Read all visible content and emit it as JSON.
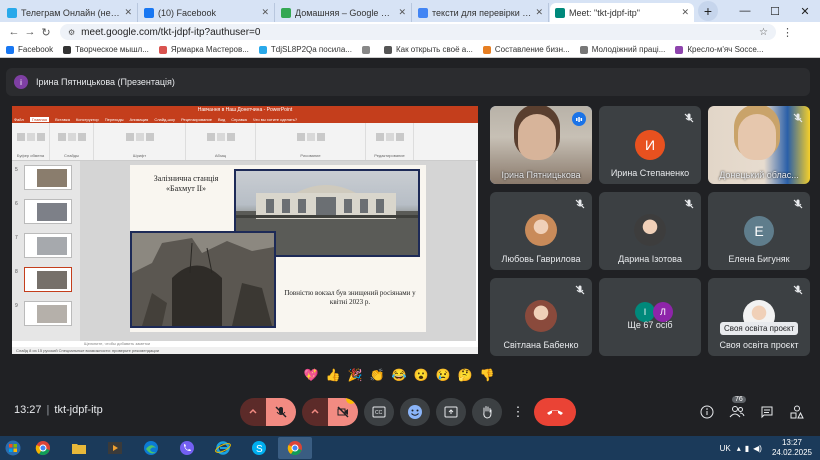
{
  "browser": {
    "tabs": [
      {
        "title": "Телеграм Онлайн (неофициа...",
        "color": "#29a9ea",
        "icon": "telegram-icon",
        "active": false
      },
      {
        "title": "(10) Facebook",
        "color": "#1877f2",
        "icon": "facebook-icon",
        "active": false
      },
      {
        "title": "Домашняя – Google Диск",
        "color": "#34a853",
        "icon": "drive-icon",
        "active": false
      },
      {
        "title": "тексти для перевірки - Goog...",
        "color": "#4285f4",
        "icon": "docs-icon",
        "active": false
      },
      {
        "title": "Meet: \"tkt-jdpf-itp\"",
        "color": "#00897b",
        "icon": "meet-icon",
        "active": true
      }
    ],
    "url": "meet.google.com/tkt-jdpf-itp?authuser=0",
    "bookmarks": [
      {
        "label": "Facebook",
        "color": "#1877f2"
      },
      {
        "label": "Творческое мышл...",
        "color": "#333333"
      },
      {
        "label": "Ярмарка Мастеров...",
        "color": "#d9534f"
      },
      {
        "label": "TdjSL8P2Qa посила...",
        "color": "#29a9ea"
      },
      {
        "label": "",
        "color": "#888888"
      },
      {
        "label": "Как открыть своё а...",
        "color": "#555555"
      },
      {
        "label": "Составление бизн...",
        "color": "#e67e22"
      },
      {
        "label": "Молодіжний праці...",
        "color": "#777777"
      },
      {
        "label": "Кресло-м'яч Socce...",
        "color": "#8e44ad"
      }
    ]
  },
  "presentation": {
    "presenter_initial": "і",
    "presenter_label": "Ірина Пятницькова (Презентація)",
    "ppt_title": "Навчання в Наш Донетчина - PowerPoint",
    "ribbon_tabs": [
      "Файл",
      "Главная",
      "Вставка",
      "Конструктор",
      "Переходы",
      "Анимация",
      "Слайд-шоу",
      "Рецензирование",
      "Вид",
      "Справка",
      "Что вы хотите сделать?"
    ],
    "ribbon_groups": [
      "Буфер обмена",
      "Слайды",
      "Шрифт",
      "Абзац",
      "Рисование",
      "Редактирование"
    ],
    "slide_title": "Залізнична станція «Бахмут ІІ»",
    "slide_caption": "Повністю вокзал був знищений росіянами у квітні 2023 р.",
    "notes_placeholder": "Щелкните, чтобы добавить заметки",
    "status_text": "Слайд 8 из 15   русский   Специальные возможности: проверьте рекомендации",
    "thumb_numbers": [
      "5",
      "6",
      "7",
      "8",
      "9"
    ]
  },
  "participants": [
    {
      "name": "Ірина Пятницькова",
      "type": "photo",
      "speaking": true
    },
    {
      "name": "Ирина Степаненко",
      "type": "letter",
      "letter": "И",
      "color": "#e8511f",
      "muted": true
    },
    {
      "name": "Донецький облас...",
      "type": "photo",
      "muted": true
    },
    {
      "name": "Любовь Гаврилова",
      "type": "avatar",
      "muted": true
    },
    {
      "name": "Дарина Ізотова",
      "type": "avatar",
      "muted": true
    },
    {
      "name": "Елена Бигуняк",
      "type": "letter",
      "letter": "Е",
      "color": "#5f7d8c",
      "muted": true
    },
    {
      "name": "Світлана Бабенко",
      "type": "avatar",
      "muted": true
    },
    {
      "name": "Ще 67 осіб",
      "type": "more",
      "letters": [
        "І",
        "Л"
      ],
      "colors": [
        "#00897b",
        "#8e24aa"
      ]
    },
    {
      "name": "Своя освіта проєкт",
      "type": "avatar",
      "muted": true
    }
  ],
  "tooltip": "Своя освіта проєкт",
  "reactions": [
    "💖",
    "👍",
    "🎉",
    "👏",
    "😂",
    "😮",
    "😢",
    "🤔",
    "👎"
  ],
  "meeting": {
    "time": "13:27",
    "code": "tkt-jdpf-itp",
    "participants_count": "76"
  },
  "taskbar": {
    "lang": "UK",
    "time": "13:27",
    "date": "24.02.2025"
  }
}
